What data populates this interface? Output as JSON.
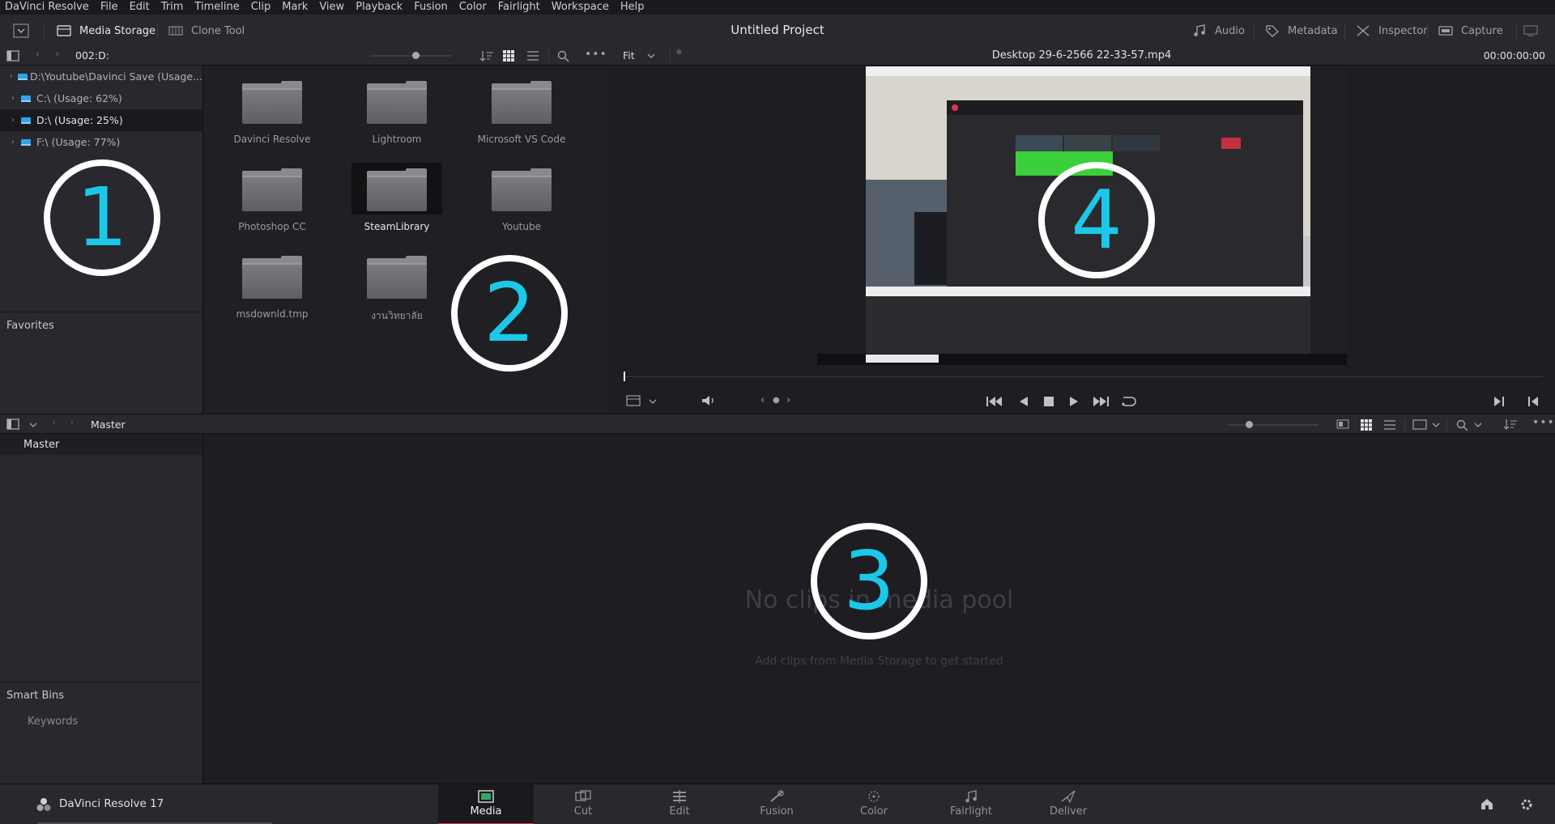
{
  "menu": [
    "DaVinci Resolve",
    "File",
    "Edit",
    "Trim",
    "Timeline",
    "Clip",
    "Mark",
    "View",
    "Playback",
    "Fusion",
    "Color",
    "Fairlight",
    "Workspace",
    "Help"
  ],
  "toolbar": {
    "media_storage": "Media Storage",
    "clone_tool": "Clone Tool",
    "project_title": "Untitled Project",
    "audio": "Audio",
    "metadata": "Metadata",
    "inspector": "Inspector",
    "capture": "Capture"
  },
  "storage": {
    "path": "002:D:",
    "drives": [
      {
        "label": "D:\\Youtube\\Davinci Save (Usage..."
      },
      {
        "label": "C:\\ (Usage: 62%)"
      },
      {
        "label": "D:\\ (Usage: 25%)"
      },
      {
        "label": "F:\\ (Usage: 77%)"
      }
    ],
    "favorites": "Favorites",
    "folders": [
      "Davinci Resolve",
      "Lightroom",
      "Microsoft VS Code",
      "Photoshop CC",
      "SteamLibrary",
      "Youtube",
      "msdownld.tmp",
      "งานวิทยาลัย"
    ]
  },
  "viewer": {
    "zoom": "Fit",
    "clip_name": "Desktop 29-6-2566 22-33-57.mp4",
    "timecode": "00:00:00:00"
  },
  "pool": {
    "breadcrumb": "Master",
    "bin": "Master",
    "smart_bins": "Smart Bins",
    "keywords": "Keywords",
    "empty_title": "No clips in media pool",
    "empty_hint": "Add clips from Media Storage to get started"
  },
  "annotations": [
    "1",
    "2",
    "3",
    "4"
  ],
  "footer": {
    "app_name": "DaVinci Resolve 17",
    "pages": [
      "Media",
      "Cut",
      "Edit",
      "Fusion",
      "Color",
      "Fairlight",
      "Deliver"
    ]
  },
  "colors": {
    "accent": "#e2344a",
    "annotation": "#1cc8e8"
  }
}
